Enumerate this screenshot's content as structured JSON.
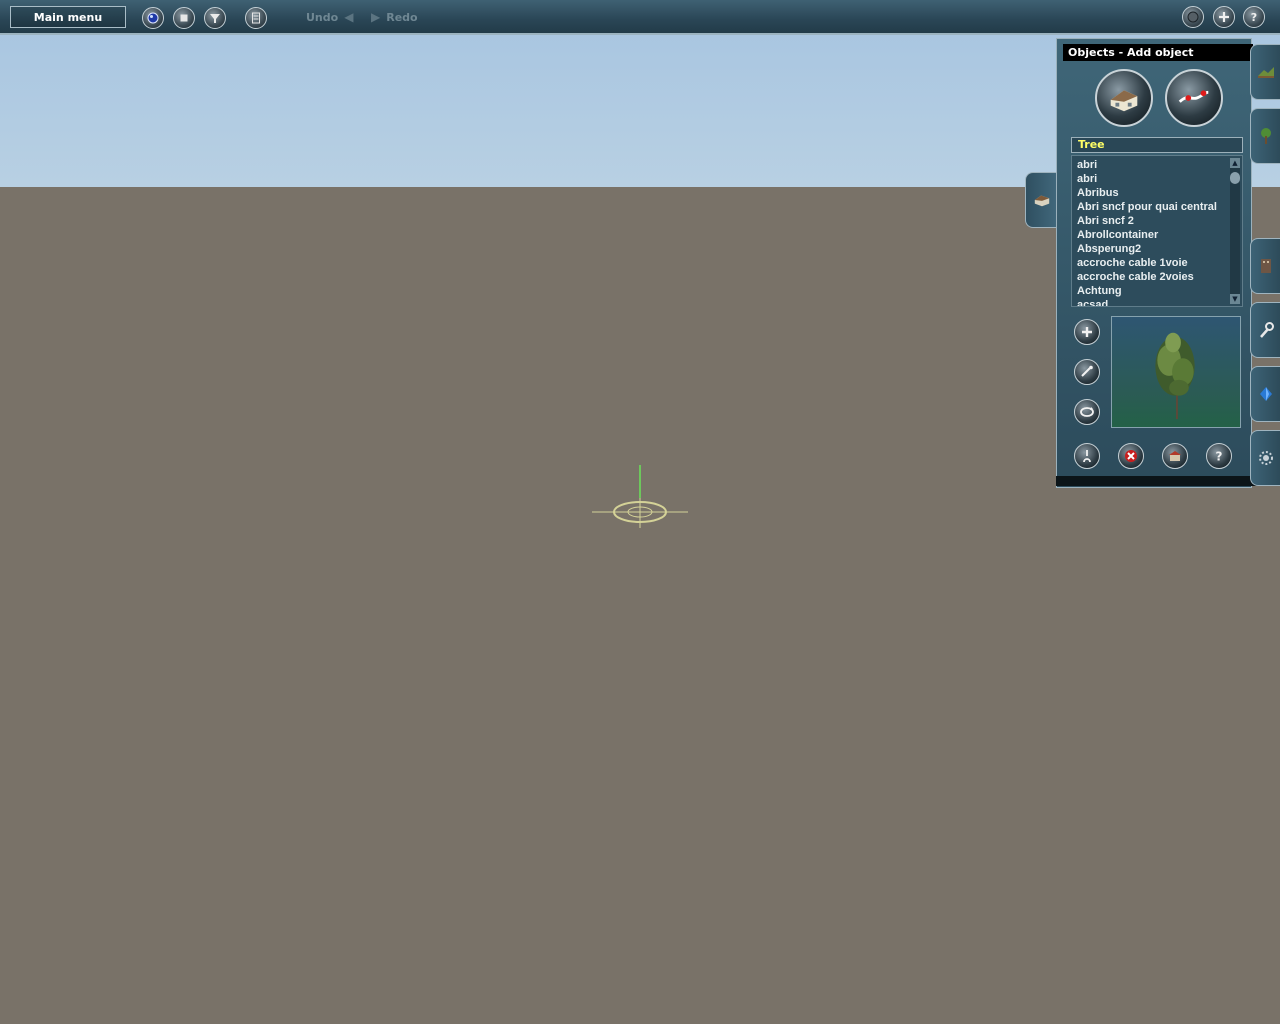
{
  "toolbar": {
    "main_menu_label": "Main menu",
    "undo_label": "Undo",
    "redo_label": "Redo",
    "left_icons": [
      "globe-icon",
      "stop-icon",
      "filter-icon",
      "calculator-icon"
    ],
    "right_icons": [
      "sphere-icon",
      "plus-icon",
      "help-icon"
    ]
  },
  "panel": {
    "title": "Objects - Add object",
    "mode_buttons": [
      "house-icon",
      "spline-track-icon"
    ],
    "category": "Tree",
    "items": [
      "abri",
      "abri",
      "Abribus",
      "Abri sncf pour quai central",
      "Abri sncf 2",
      "Abrollcontainer",
      "Absperung2",
      "accroche cable 1voie",
      "accroche cable 2voies",
      "Achtung",
      "acsad"
    ],
    "tool_icons": [
      "add-object-icon",
      "edit-object-icon",
      "rotate-object-icon"
    ],
    "bottom_icons": [
      "pick-icon",
      "delete-icon",
      "properties-icon",
      "help-icon"
    ],
    "preview_subject": "tree"
  },
  "right_tabs": [
    "terrain-tab",
    "landscape-tab",
    "assets-tab",
    "tools-tab",
    "water-tab",
    "settings-tab"
  ],
  "colors": {
    "sky": "#b4cde2",
    "ground": "#797268",
    "grid_major": "#f3e37a",
    "grid_minor": "#6f695f",
    "ui_panel": "#3a5e70"
  }
}
